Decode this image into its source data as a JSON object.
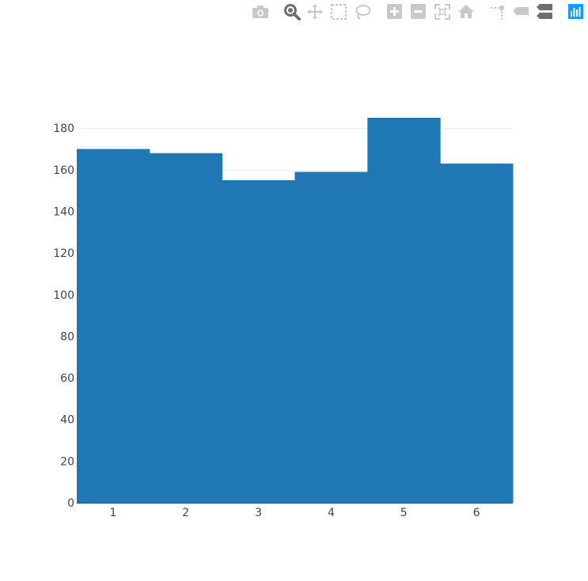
{
  "modebar": {
    "buttons": [
      {
        "icon": "camera-icon",
        "title": "Download plot as a png"
      },
      {
        "icon": "zoom-icon",
        "title": "Zoom",
        "active": true
      },
      {
        "icon": "pan-icon",
        "title": "Pan"
      },
      {
        "icon": "box-select-icon",
        "title": "Box Select"
      },
      {
        "icon": "lasso-select-icon",
        "title": "Lasso Select"
      },
      {
        "icon": "zoom-in-icon",
        "title": "Zoom in"
      },
      {
        "icon": "zoom-out-icon",
        "title": "Zoom out"
      },
      {
        "icon": "autoscale-icon",
        "title": "Autoscale"
      },
      {
        "icon": "home-icon",
        "title": "Reset axes"
      },
      {
        "icon": "spike-lines-icon",
        "title": "Toggle Spike Lines"
      },
      {
        "icon": "hover-closest-icon",
        "title": "Show closest data on hover"
      },
      {
        "icon": "hover-compare-icon",
        "title": "Compare data on hover",
        "active": true
      },
      {
        "icon": "plotly-logo-icon",
        "title": "Produced with Plotly"
      }
    ],
    "icon_color": "#c8c8c8",
    "active_color": "#6e6e6e",
    "logo_color": "#119dff"
  },
  "chart_data": {
    "type": "bar",
    "categories": [
      "1",
      "2",
      "3",
      "4",
      "5",
      "6"
    ],
    "values": [
      170,
      168,
      155,
      159,
      185,
      163
    ],
    "bar_color": "#1f77b4",
    "bar_gap": 0,
    "title": "",
    "xlabel": "",
    "ylabel": "",
    "ylim": [
      0,
      185
    ],
    "yticks": [
      0,
      20,
      40,
      60,
      80,
      100,
      120,
      140,
      160,
      180
    ],
    "grid": true,
    "legend": false
  }
}
